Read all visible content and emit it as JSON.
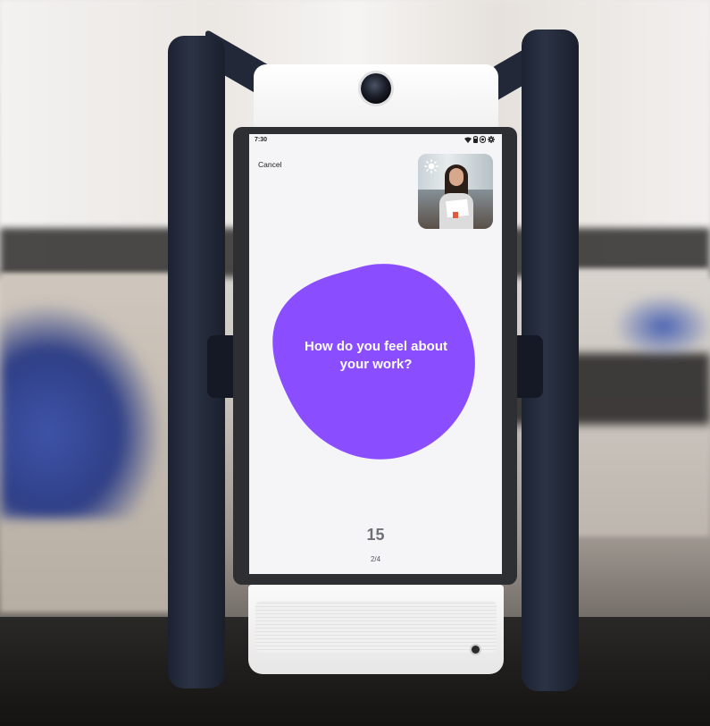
{
  "status_bar": {
    "time": "7:30",
    "icons": [
      "wifi-icon",
      "battery-icon",
      "record-icon",
      "settings-icon"
    ]
  },
  "screen": {
    "cancel_label": "Cancel",
    "question": "How do you feel about your work?",
    "countdown": "15",
    "progress": "2/4"
  },
  "colors": {
    "accent": "#8a4dff",
    "screen_bg": "#f5f5f7"
  },
  "camera_preview": {
    "icon": "sun-icon"
  }
}
